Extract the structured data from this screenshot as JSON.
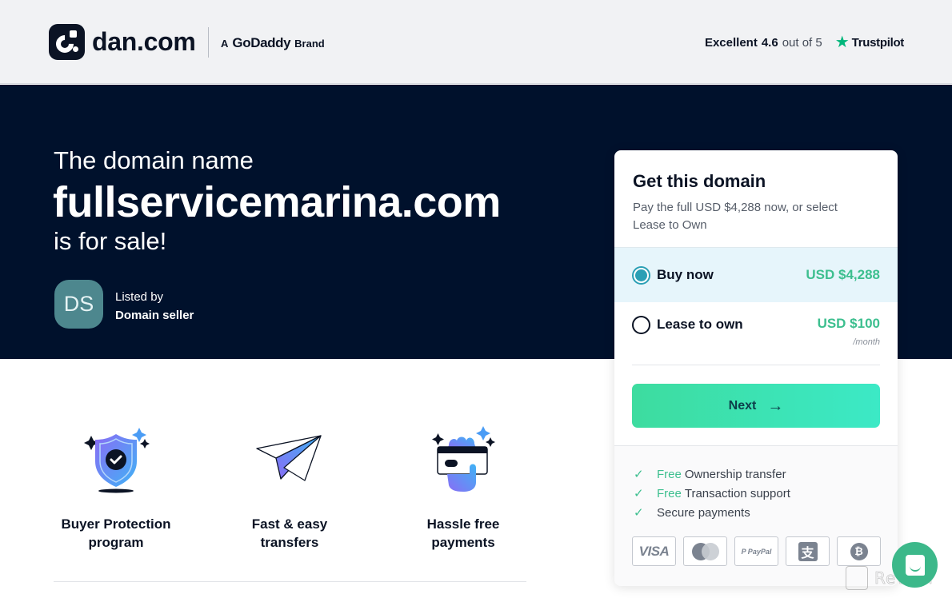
{
  "header": {
    "logo_text": "dan.com",
    "godaddy": {
      "prefix": "A",
      "name": "GoDaddy",
      "suffix": "Brand"
    },
    "trustpilot": {
      "excellent": "Excellent",
      "rating": "4.6",
      "out_of": "out of 5",
      "brand": "Trustpilot",
      "star_icon": "★"
    }
  },
  "hero": {
    "line1": "The domain name",
    "domain": "fullservicemarina.com",
    "line3": "is for sale!",
    "seller": {
      "initials": "DS",
      "listed_by": "Listed by",
      "name": "Domain seller"
    }
  },
  "features": [
    {
      "icon": "shield-check-icon",
      "label_line1": "Buyer Protection",
      "label_line2": "program"
    },
    {
      "icon": "paper-plane-icon",
      "label_line1": "Fast & easy",
      "label_line2": "transfers"
    },
    {
      "icon": "hand-card-icon",
      "label_line1": "Hassle free",
      "label_line2": "payments"
    }
  ],
  "card": {
    "title": "Get this domain",
    "subtitle": "Pay the full USD $4,288 now, or select Lease to Own",
    "options": [
      {
        "label": "Buy now",
        "price": "USD $4,288",
        "selected": true
      },
      {
        "label": "Lease to own",
        "price": "USD $100",
        "period": "/month",
        "selected": false
      }
    ],
    "next_label": "Next",
    "next_arrow": "→",
    "benefits": [
      {
        "free": "Free",
        "text": "Ownership transfer"
      },
      {
        "free": "Free",
        "text": "Transaction support"
      },
      {
        "free": "",
        "text": "Secure payments"
      }
    ],
    "check_icon": "✓",
    "payment_methods": [
      {
        "name": "visa",
        "label": "VISA"
      },
      {
        "name": "mastercard",
        "label": ""
      },
      {
        "name": "paypal",
        "label": "P PayPal"
      },
      {
        "name": "alipay",
        "label": "支"
      },
      {
        "name": "bitcoin",
        "label": "₿"
      }
    ]
  },
  "watermark": {
    "text": "Revain"
  },
  "colors": {
    "navy": "#00112c",
    "accent_green": "#3dbf8f",
    "button_gradient_start": "#3ddc9f",
    "button_gradient_end": "#3ce9c6",
    "selected_bg": "#e6f5fb",
    "radio_selected": "#2a9fb5",
    "avatar_bg": "#4d878e",
    "trustpilot_green": "#00b67a"
  }
}
